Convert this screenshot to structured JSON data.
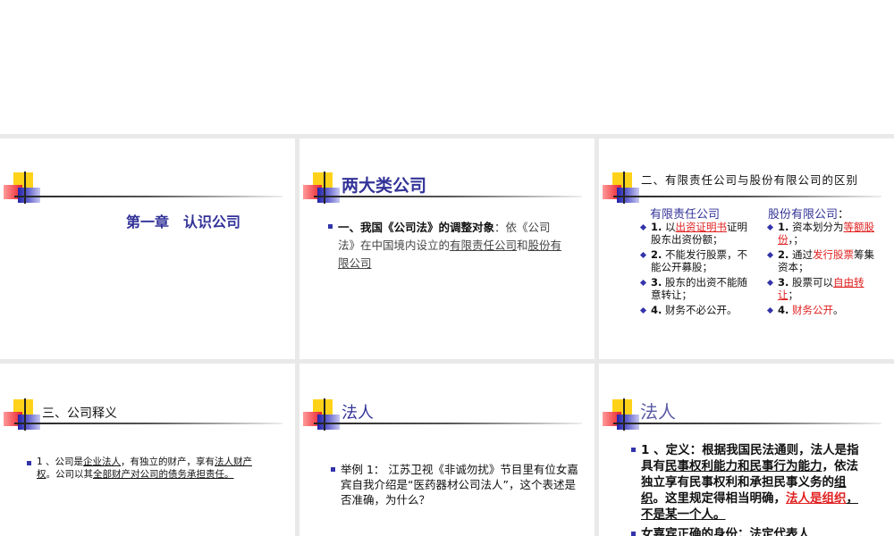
{
  "slides": [
    {
      "title": "第一章　认识公司"
    },
    {
      "title": "两大类公司",
      "body": {
        "lead": "一、我国《公司法》的调整对象",
        "rest": "：依《公司法》在中国境内设立的",
        "u1": "有限责任公司",
        "and": "和",
        "u2": "股份有限公司"
      }
    },
    {
      "title": "二、有限责任公司与股份有限公司的区别",
      "left": {
        "heading": "有限责任公司",
        "items": [
          {
            "num": "1.",
            "a": " 以",
            "red": "出资证明书",
            "b": "证明股东出资份额；"
          },
          {
            "num": "2.",
            "a": " 不能发行股票，不能公开募股；"
          },
          {
            "num": "3.",
            "a": " 股东的出资不能随意转让；"
          },
          {
            "num": "4.",
            "a": "  财务不必公开。"
          }
        ]
      },
      "right": {
        "heading": "股份有限公司",
        "colon": "：",
        "items": [
          {
            "num": "1.",
            "a": " 资本划分为",
            "red": "等额股份",
            "b": "，；"
          },
          {
            "num": "2.",
            "a": " 通过",
            "red": "发行股票",
            "b": "筹集资本；"
          },
          {
            "num": "3.",
            "a": " 股票可以",
            "red": "自由转让",
            "b": "；"
          },
          {
            "num": " 4.",
            "a": " ",
            "red": "财务公开",
            "b": "。"
          }
        ]
      }
    },
    {
      "title": "三、公司释义",
      "body": {
        "a": "1 、公司是",
        "u1": "企业法人",
        "b": "，有独立的财产，享有",
        "u2": "法人财产权",
        "c": "。公司以其",
        "u3": "全部财产对公司的债务承担责任。"
      }
    },
    {
      "title": "法人",
      "body": "举例 1： 江苏卫视《非诚勿扰》节目里有位女嘉宾自我介绍是“医药器材公司法人”，这个表述是否准确，为什么？"
    },
    {
      "title": "法人",
      "body": {
        "a": "1 、定义：根据我国民法通则，法人是指具有",
        "u1": "民事权利能力和民事行为能力",
        "b": "，依法独立享有民事权利和承担民事义务的",
        "u2": "组织",
        "c": "。这里规定得相当明确，",
        "red": "法人是组织",
        "d": "，不是某一个人。",
        "second": "女嘉宾正确的身份：法定代表人"
      }
    }
  ],
  "colors": {
    "title_blue": "#333399",
    "red": "#e02020",
    "bullet": "#3333aa"
  }
}
